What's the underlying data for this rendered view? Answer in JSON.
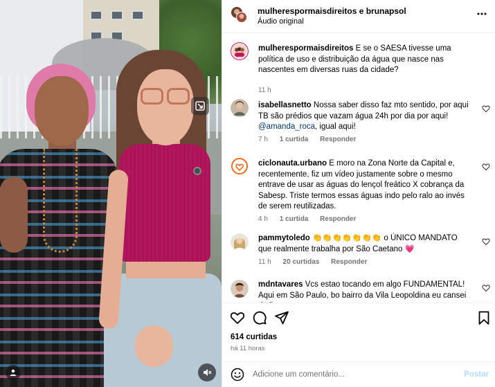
{
  "header": {
    "names": "mulherespormaisdireitos e brunapsol",
    "audio": "Áudio original"
  },
  "caption": {
    "username": "mulherespormaisdireitos",
    "text": " E se o SAESA tivesse uma política de uso e distribuição da água que nasce nas nascentes em diversas ruas da cidade?",
    "time": "11 h"
  },
  "comments": [
    {
      "username": "isabellasnetto",
      "text": " Nossa saber disso faz mto sentido, por aqui TB são prédios que vazam água 24h por dia por aqui!",
      "mention": "@amanda_roca",
      "after_mention": ", igual aqui!",
      "time": "7 h",
      "likes": "1 curtida",
      "reply": "Responder"
    },
    {
      "username": "ciclonauta.urbano",
      "text": " E moro na Zona Norte da Capital e, recentemente, fiz um vídeo justamente sobre o mesmo entrave de usar as águas do lençol freático X cobrança da Sabesp. Triste termos essas águas indo pelo ralo ao invés de serem reutilizadas.",
      "time": "4 h",
      "likes": "1 curtida",
      "reply": "Responder"
    },
    {
      "username": "pammytoledo",
      "text": " 👏👏👏👏👏👏👏 o ÚNICO MANDATO que realmente trabalha por São Caetano 💗",
      "time": "11 h",
      "likes": "20 curtidas",
      "reply": "Responder"
    },
    {
      "username": "mdntavares",
      "text": " Vcs estao tocando em algo FUNDAMENTAL! Aqui em São Paulo, bo bairro da Vila Leopoldina eu cansei de ligar"
    }
  ],
  "stats": {
    "likes": "614 curtidas",
    "time": "há 11 horas"
  },
  "composer": {
    "placeholder": "Adicione um comentário...",
    "post_label": "Postar"
  },
  "icons": {
    "like": "heart-icon",
    "comment": "comment-icon",
    "share": "send-icon",
    "save": "bookmark-icon",
    "more": "more-options-icon",
    "emoji": "emoji-icon",
    "mute": "muted-speaker-icon",
    "tagged": "person-icon"
  },
  "colors": {
    "mention": "#00376b",
    "secondary_text": "#737373",
    "post_disabled": "#b3dbff",
    "heart_pink": "#e8307a"
  }
}
